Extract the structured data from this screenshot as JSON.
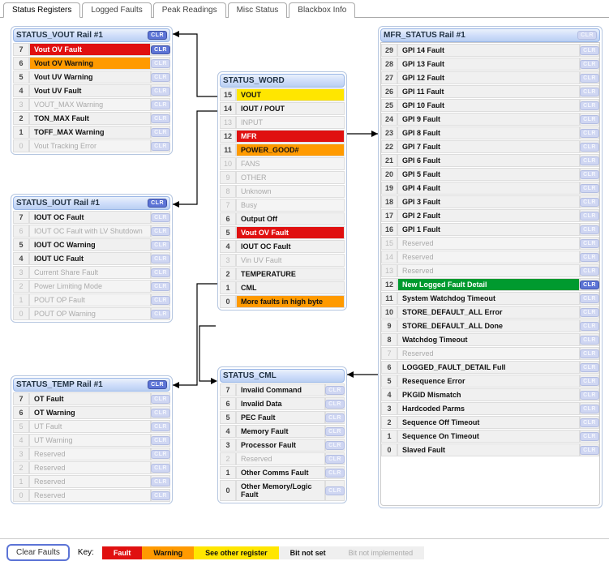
{
  "tabs": [
    {
      "label": "Status Registers",
      "active": true
    },
    {
      "label": "Logged Faults",
      "active": false
    },
    {
      "label": "Peak Readings",
      "active": false
    },
    {
      "label": "Misc Status",
      "active": false
    },
    {
      "label": "Blackbox Info",
      "active": false
    }
  ],
  "clr_label": "CLR",
  "panels": {
    "vout": {
      "title": "STATUS_VOUT Rail #1",
      "bits": [
        {
          "n": 7,
          "label": "Vout OV Fault",
          "state": "fault",
          "clr": "active"
        },
        {
          "n": 6,
          "label": "Vout OV Warning",
          "state": "warning",
          "clr": "dim"
        },
        {
          "n": 5,
          "label": "Vout UV Warning",
          "state": "notset",
          "clr": "dim"
        },
        {
          "n": 4,
          "label": "Vout UV Fault",
          "state": "notset",
          "clr": "dim"
        },
        {
          "n": 3,
          "label": "VOUT_MAX Warning",
          "state": "notimpl",
          "clr": "dim"
        },
        {
          "n": 2,
          "label": "TON_MAX Fault",
          "state": "notset",
          "clr": "dim"
        },
        {
          "n": 1,
          "label": "TOFF_MAX Warning",
          "state": "notset",
          "clr": "dim"
        },
        {
          "n": 0,
          "label": "Vout Tracking Error",
          "state": "notimpl",
          "clr": "dim"
        }
      ]
    },
    "iout": {
      "title": "STATUS_IOUT Rail #1",
      "bits": [
        {
          "n": 7,
          "label": "IOUT OC Fault",
          "state": "notset",
          "clr": "dim"
        },
        {
          "n": 6,
          "label": "IOUT OC Fault with LV Shutdown",
          "state": "notimpl",
          "clr": "dim"
        },
        {
          "n": 5,
          "label": "IOUT OC Warning",
          "state": "notset",
          "clr": "dim"
        },
        {
          "n": 4,
          "label": "IOUT UC Fault",
          "state": "notset",
          "clr": "dim"
        },
        {
          "n": 3,
          "label": "Current Share Fault",
          "state": "notimpl",
          "clr": "dim"
        },
        {
          "n": 2,
          "label": "Power Limiting Mode",
          "state": "notimpl",
          "clr": "dim"
        },
        {
          "n": 1,
          "label": "POUT OP Fault",
          "state": "notimpl",
          "clr": "dim"
        },
        {
          "n": 0,
          "label": "POUT OP Warning",
          "state": "notimpl",
          "clr": "dim"
        }
      ]
    },
    "temp": {
      "title": "STATUS_TEMP Rail #1",
      "bits": [
        {
          "n": 7,
          "label": "OT Fault",
          "state": "notset",
          "clr": "dim"
        },
        {
          "n": 6,
          "label": "OT Warning",
          "state": "notset",
          "clr": "dim"
        },
        {
          "n": 5,
          "label": "UT Fault",
          "state": "notimpl",
          "clr": "dim"
        },
        {
          "n": 4,
          "label": "UT Warning",
          "state": "notimpl",
          "clr": "dim"
        },
        {
          "n": 3,
          "label": "Reserved",
          "state": "notimpl",
          "clr": "dim"
        },
        {
          "n": 2,
          "label": "Reserved",
          "state": "notimpl",
          "clr": "dim"
        },
        {
          "n": 1,
          "label": "Reserved",
          "state": "notimpl",
          "clr": "dim"
        },
        {
          "n": 0,
          "label": "Reserved",
          "state": "notimpl",
          "clr": "dim"
        }
      ]
    },
    "word": {
      "title": "STATUS_WORD",
      "bits": [
        {
          "n": 15,
          "label": "VOUT",
          "state": "seeother",
          "clr": null
        },
        {
          "n": 14,
          "label": "IOUT / POUT",
          "state": "notset",
          "clr": null
        },
        {
          "n": 13,
          "label": "INPUT",
          "state": "notimpl",
          "clr": null
        },
        {
          "n": 12,
          "label": "MFR",
          "state": "fault",
          "clr": null
        },
        {
          "n": 11,
          "label": "POWER_GOOD#",
          "state": "warning",
          "clr": null
        },
        {
          "n": 10,
          "label": "FANS",
          "state": "notimpl",
          "clr": null
        },
        {
          "n": 9,
          "label": "OTHER",
          "state": "notimpl",
          "clr": null
        },
        {
          "n": 8,
          "label": "Unknown",
          "state": "notimpl",
          "clr": null
        },
        {
          "n": 7,
          "label": "Busy",
          "state": "notimpl",
          "clr": null
        },
        {
          "n": 6,
          "label": "Output Off",
          "state": "notset",
          "clr": null
        },
        {
          "n": 5,
          "label": "Vout OV Fault",
          "state": "fault",
          "clr": null
        },
        {
          "n": 4,
          "label": "IOUT OC Fault",
          "state": "notset",
          "clr": null
        },
        {
          "n": 3,
          "label": "Vin UV Fault",
          "state": "notimpl",
          "clr": null
        },
        {
          "n": 2,
          "label": "TEMPERATURE",
          "state": "notset",
          "clr": null
        },
        {
          "n": 1,
          "label": "CML",
          "state": "notset",
          "clr": null
        },
        {
          "n": 0,
          "label": "More faults in high byte",
          "state": "warning",
          "clr": null
        }
      ]
    },
    "cml": {
      "title": "STATUS_CML",
      "bits": [
        {
          "n": 7,
          "label": "Invalid Command",
          "state": "notset",
          "clr": "dim"
        },
        {
          "n": 6,
          "label": "Invalid Data",
          "state": "notset",
          "clr": "dim"
        },
        {
          "n": 5,
          "label": "PEC Fault",
          "state": "notset",
          "clr": "dim"
        },
        {
          "n": 4,
          "label": "Memory Fault",
          "state": "notset",
          "clr": "dim"
        },
        {
          "n": 3,
          "label": "Processor Fault",
          "state": "notset",
          "clr": "dim"
        },
        {
          "n": 2,
          "label": "Reserved",
          "state": "notimpl",
          "clr": "dim"
        },
        {
          "n": 1,
          "label": "Other Comms Fault",
          "state": "notset",
          "clr": "dim"
        },
        {
          "n": 0,
          "label": "Other Memory/Logic Fault",
          "state": "notset",
          "clr": "dim"
        }
      ]
    },
    "mfr": {
      "title": "MFR_STATUS Rail #1",
      "bits": [
        {
          "n": 29,
          "label": "GPI 14 Fault",
          "state": "notset",
          "clr": "dim"
        },
        {
          "n": 28,
          "label": "GPI 13 Fault",
          "state": "notset",
          "clr": "dim"
        },
        {
          "n": 27,
          "label": "GPI 12 Fault",
          "state": "notset",
          "clr": "dim"
        },
        {
          "n": 26,
          "label": "GPI 11 Fault",
          "state": "notset",
          "clr": "dim"
        },
        {
          "n": 25,
          "label": "GPI 10 Fault",
          "state": "notset",
          "clr": "dim"
        },
        {
          "n": 24,
          "label": "GPI 9 Fault",
          "state": "notset",
          "clr": "dim"
        },
        {
          "n": 23,
          "label": "GPI 8 Fault",
          "state": "notset",
          "clr": "dim"
        },
        {
          "n": 22,
          "label": "GPI 7 Fault",
          "state": "notset",
          "clr": "dim"
        },
        {
          "n": 21,
          "label": "GPI 6 Fault",
          "state": "notset",
          "clr": "dim"
        },
        {
          "n": 20,
          "label": "GPI 5 Fault",
          "state": "notset",
          "clr": "dim"
        },
        {
          "n": 19,
          "label": "GPI 4 Fault",
          "state": "notset",
          "clr": "dim"
        },
        {
          "n": 18,
          "label": "GPI 3 Fault",
          "state": "notset",
          "clr": "dim"
        },
        {
          "n": 17,
          "label": "GPI 2 Fault",
          "state": "notset",
          "clr": "dim"
        },
        {
          "n": 16,
          "label": "GPI 1 Fault",
          "state": "notset",
          "clr": "dim"
        },
        {
          "n": 15,
          "label": "Reserved",
          "state": "notimpl",
          "clr": "dim"
        },
        {
          "n": 14,
          "label": "Reserved",
          "state": "notimpl",
          "clr": "dim"
        },
        {
          "n": 13,
          "label": "Reserved",
          "state": "notimpl",
          "clr": "dim"
        },
        {
          "n": 12,
          "label": "New Logged Fault Detail",
          "state": "green",
          "clr": "active"
        },
        {
          "n": 11,
          "label": "System Watchdog Timeout",
          "state": "notset",
          "clr": "dim"
        },
        {
          "n": 10,
          "label": "STORE_DEFAULT_ALL Error",
          "state": "notset",
          "clr": "dim"
        },
        {
          "n": 9,
          "label": "STORE_DEFAULT_ALL Done",
          "state": "notset",
          "clr": "dim"
        },
        {
          "n": 8,
          "label": "Watchdog Timeout",
          "state": "notset",
          "clr": "dim"
        },
        {
          "n": 7,
          "label": "Reserved",
          "state": "notimpl",
          "clr": "dim"
        },
        {
          "n": 6,
          "label": "LOGGED_FAULT_DETAIL Full",
          "state": "notset",
          "clr": "dim"
        },
        {
          "n": 5,
          "label": "Resequence Error",
          "state": "notset",
          "clr": "dim"
        },
        {
          "n": 4,
          "label": "PKGID Mismatch",
          "state": "notset",
          "clr": "dim"
        },
        {
          "n": 3,
          "label": "Hardcoded Parms",
          "state": "notset",
          "clr": "dim"
        },
        {
          "n": 2,
          "label": "Sequence Off Timeout",
          "state": "notset",
          "clr": "dim"
        },
        {
          "n": 1,
          "label": "Sequence On Timeout",
          "state": "notset",
          "clr": "dim"
        },
        {
          "n": 0,
          "label": "Slaved Fault",
          "state": "notset",
          "clr": "dim"
        }
      ]
    }
  },
  "footer": {
    "clear_faults": "Clear Faults",
    "key_label": "Key:",
    "swatches": [
      {
        "label": "Fault",
        "cls": "sw-fault"
      },
      {
        "label": "Warning",
        "cls": "sw-warn"
      },
      {
        "label": "See other register",
        "cls": "sw-see"
      },
      {
        "label": "Bit not set",
        "cls": "sw-ns"
      },
      {
        "label": "Bit not implemented",
        "cls": "sw-ni"
      }
    ]
  }
}
